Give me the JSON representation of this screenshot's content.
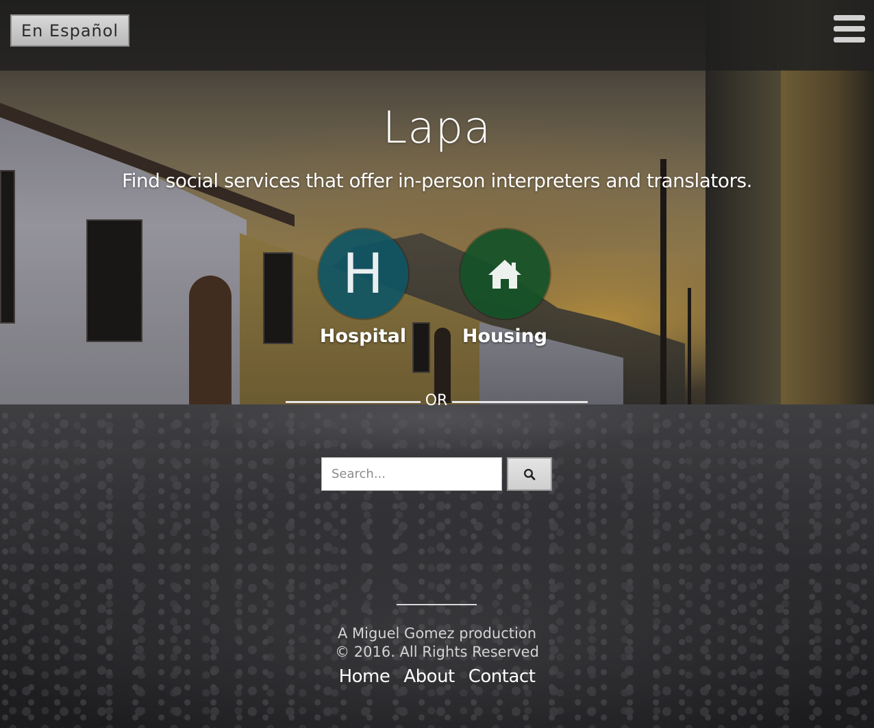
{
  "header": {
    "language_button": "En Español",
    "menu_icon": "hamburger-icon"
  },
  "hero": {
    "title": "Lapa",
    "tagline": "Find social services that offer in-person interpreters and translators."
  },
  "categories": [
    {
      "label": "Hospital",
      "icon": "hospital-h-icon",
      "glyph": "H",
      "color": "#0f5564"
    },
    {
      "label": "Housing",
      "icon": "house-icon",
      "color": "#145228"
    }
  ],
  "divider": {
    "text": "OR"
  },
  "search": {
    "placeholder": "Search...",
    "value": "",
    "button_icon": "search-icon"
  },
  "footer": {
    "credit": "A Miguel Gomez production",
    "copyright": "© 2016. All Rights Reserved",
    "links": [
      "Home",
      "About",
      "Contact"
    ]
  }
}
